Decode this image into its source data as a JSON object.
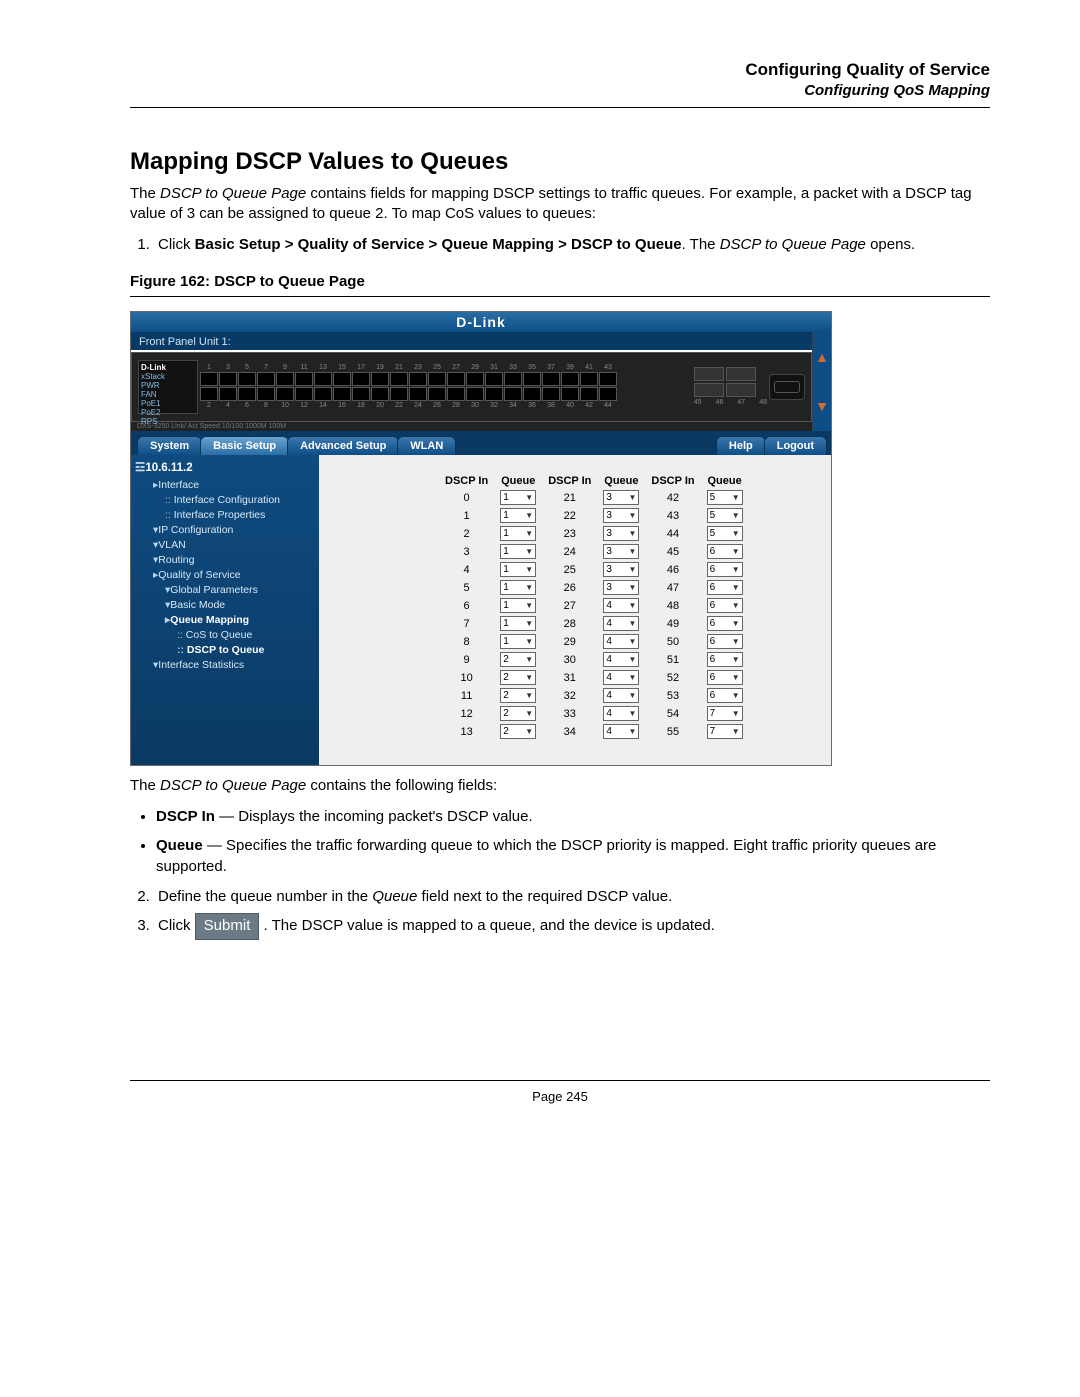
{
  "header": {
    "title": "Configuring Quality of Service",
    "subtitle": "Configuring QoS Mapping"
  },
  "section_heading": "Mapping DSCP Values to Queues",
  "intro_1": "The ",
  "intro_em": "DSCP to Queue Page",
  "intro_2": " contains fields for mapping DSCP settings to traffic queues. For example, a packet with a DSCP tag value of 3 can be assigned to queue 2. To map CoS values to queues:",
  "step1_a": "Click ",
  "step1_bold": "Basic Setup > Quality of Service > Queue Mapping > DSCP to Queue",
  "step1_b": ". The ",
  "step1_em": "DSCP to Queue Page",
  "step1_c": " opens.",
  "figure_caption": "Figure 162: DSCP to Queue Page",
  "screenshot": {
    "brand": "D-Link",
    "front_panel_label": "Front Panel Unit 1:",
    "switch": {
      "brand": "D-Link",
      "lines": [
        "xStack",
        "PWR",
        "FAN",
        "PoE1",
        "PoE2",
        "RPS"
      ],
      "model_line": "DXS-3250  Link/ Act Speed  10/100  1000M  100M",
      "port_numbers_top": [
        "1",
        "3",
        "5",
        "7",
        "9",
        "11",
        "13",
        "15",
        "17",
        "19",
        "21",
        "23",
        "25",
        "27",
        "29",
        "31",
        "33",
        "35",
        "37",
        "39",
        "41",
        "43"
      ],
      "port_numbers_bot": [
        "2",
        "4",
        "6",
        "8",
        "10",
        "12",
        "14",
        "16",
        "18",
        "20",
        "22",
        "24",
        "26",
        "28",
        "30",
        "32",
        "34",
        "36",
        "38",
        "40",
        "42",
        "44"
      ],
      "sfp_numbers": [
        "45",
        "46",
        "47",
        "48"
      ]
    },
    "tabs": {
      "system": "System",
      "basic": "Basic Setup",
      "advanced": "Advanced Setup",
      "wlan": "WLAN",
      "help": "Help",
      "logout": "Logout"
    },
    "tree": {
      "ip": "10.6.11.2",
      "items": [
        {
          "cls": "lv1 tri",
          "label": "Interface"
        },
        {
          "cls": "lv2 dot",
          "label": "Interface Configuration"
        },
        {
          "cls": "lv2 dot",
          "label": "Interface Properties"
        },
        {
          "cls": "lv1 trd",
          "label": "IP Configuration"
        },
        {
          "cls": "lv1 trd",
          "label": "VLAN"
        },
        {
          "cls": "lv1 trd",
          "label": "Routing"
        },
        {
          "cls": "lv1 tri",
          "label": "Quality of Service"
        },
        {
          "cls": "lv2 trd",
          "label": "Global Parameters"
        },
        {
          "cls": "lv2 trd",
          "label": "Basic Mode"
        },
        {
          "cls": "lv2 tri sel",
          "label": "Queue Mapping"
        },
        {
          "cls": "lv3 dot",
          "label": "CoS to Queue"
        },
        {
          "cls": "lv3 dot sel",
          "label": "DSCP to Queue"
        },
        {
          "cls": "lv1 trd",
          "label": "Interface Statistics"
        }
      ]
    },
    "table_headers": {
      "dscp": "DSCP In",
      "queue": "Queue"
    },
    "rows": [
      {
        "d1": "0",
        "q1": "1",
        "d2": "21",
        "q2": "3",
        "d3": "42",
        "q3": "5"
      },
      {
        "d1": "1",
        "q1": "1",
        "d2": "22",
        "q2": "3",
        "d3": "43",
        "q3": "5"
      },
      {
        "d1": "2",
        "q1": "1",
        "d2": "23",
        "q2": "3",
        "d3": "44",
        "q3": "5"
      },
      {
        "d1": "3",
        "q1": "1",
        "d2": "24",
        "q2": "3",
        "d3": "45",
        "q3": "6"
      },
      {
        "d1": "4",
        "q1": "1",
        "d2": "25",
        "q2": "3",
        "d3": "46",
        "q3": "6"
      },
      {
        "d1": "5",
        "q1": "1",
        "d2": "26",
        "q2": "3",
        "d3": "47",
        "q3": "6"
      },
      {
        "d1": "6",
        "q1": "1",
        "d2": "27",
        "q2": "4",
        "d3": "48",
        "q3": "6"
      },
      {
        "d1": "7",
        "q1": "1",
        "d2": "28",
        "q2": "4",
        "d3": "49",
        "q3": "6"
      },
      {
        "d1": "8",
        "q1": "1",
        "d2": "29",
        "q2": "4",
        "d3": "50",
        "q3": "6"
      },
      {
        "d1": "9",
        "q1": "2",
        "d2": "30",
        "q2": "4",
        "d3": "51",
        "q3": "6"
      },
      {
        "d1": "10",
        "q1": "2",
        "d2": "31",
        "q2": "4",
        "d3": "52",
        "q3": "6"
      },
      {
        "d1": "11",
        "q1": "2",
        "d2": "32",
        "q2": "4",
        "d3": "53",
        "q3": "6"
      },
      {
        "d1": "12",
        "q1": "2",
        "d2": "33",
        "q2": "4",
        "d3": "54",
        "q3": "7"
      },
      {
        "d1": "13",
        "q1": "2",
        "d2": "34",
        "q2": "4",
        "d3": "55",
        "q3": "7"
      }
    ]
  },
  "post_fig_1a": "The ",
  "post_fig_1em": "DSCP to Queue Page",
  "post_fig_1b": " contains the following fields:",
  "bullet1_b": "DSCP In",
  "bullet1_t": " — Displays the incoming packet's DSCP value.",
  "bullet2_b": "Queue",
  "bullet2_t": " — Specifies the traffic forwarding queue to which the DSCP priority is mapped. Eight traffic priority queues are supported.",
  "step2_a": "Define the queue number in the ",
  "step2_em": "Queue",
  "step2_b": " field next to the required DSCP value.",
  "step3_a": "Click ",
  "step3_btn": "Submit",
  "step3_b": ". The DSCP value is mapped to a queue, and the device is updated.",
  "footer": "Page 245"
}
